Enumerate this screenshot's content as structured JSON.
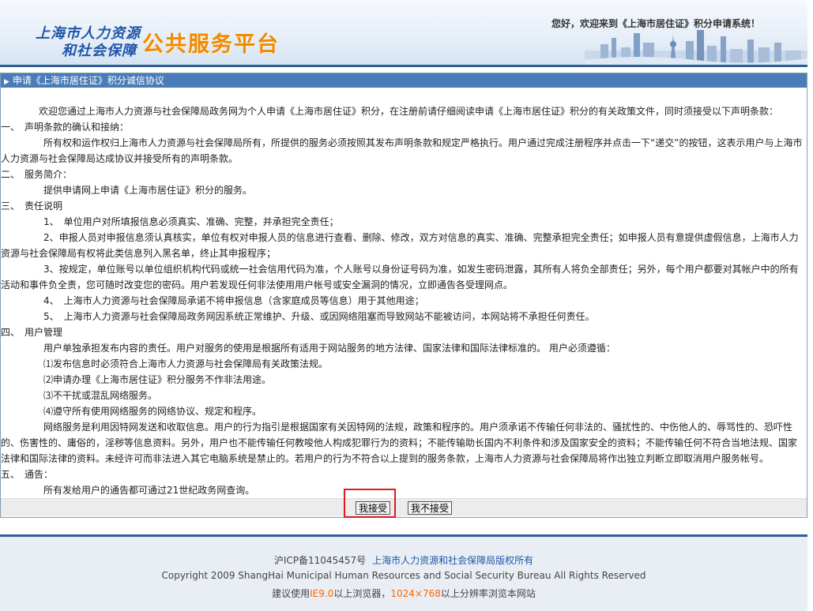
{
  "header": {
    "logo_line1": "上海市人力资源",
    "logo_line2": "和社会保障",
    "logo_platform": "公共服务平台",
    "welcome": "您好，欢迎来到《上海市居住证》积分申请系统！"
  },
  "panel": {
    "title": "申请《上海市居住证》积分诚信协议"
  },
  "content": {
    "intro": "欢迎您通过上海市人力资源与社会保障局政务网为个人申请《上海市居住证》积分，在注册前请仔细阅读申请《上海市居住证》积分的有关政策文件，同时须接受以下声明条款：",
    "s1_title": "一、　声明条款的确认和接纳：",
    "s1_text": "所有权和运作权归上海市人力资源与社会保障局所有，所提供的服务必须按照其发布声明条款和规定严格执行。用户通过完成注册程序并点击一下“递交”的按钮，这表示用户与上海市人力资源与社会保障局达成协议并接受所有的声明条款。",
    "s2_title": "二、　服务简介：",
    "s2_text": "提供申请网上申请《上海市居住证》积分的服务。",
    "s3_title": "三、　责任说明",
    "s3_item1": "1、　单位用户对所填报信息必须真实、准确、完整，并承担完全责任；",
    "s3_item2": "2、申报人员对申报信息须认真核实，单位有权对申报人员的信息进行查看、删除、修改，双方对信息的真实、准确、完整承担完全责任；如申报人员有意提供虚假信息，上海市人力资源与社会保障局有权将此类信息列入黑名单，终止其申报程序；",
    "s3_item3": "3、按规定，单位账号以单位组织机构代码或统一社会信用代码为准，个人账号以身份证号码为准，如发生密码泄露，其所有人将负全部责任；另外，每个用户都要对其帐户中的所有活动和事件负全责，您可随时改变您的密码。用户若发现任何非法使用用户帐号或安全漏洞的情况，立即通告各受理网点。",
    "s3_item4": "4、　上海市人力资源与社会保障局承诺不将申报信息（含家庭成员等信息）用于其他用途；",
    "s3_item5": "5、　上海市人力资源与社会保障局政务网因系统正常维护、升级、或因网络阻塞而导致网站不能被访问，本网站将不承担任何责任。",
    "s4_title": "四、　用户管理",
    "s4_text": "用户单独承担发布内容的责任。用户对服务的使用是根据所有适用于网站服务的地方法律、国家法律和国际法律标准的。 用户必须遵循：",
    "s4_item1": "⑴发布信息时必须符合上海市人力资源与社会保障局有关政策法规。",
    "s4_item2": "⑵申请办理《上海市居住证》积分服务不作非法用途。",
    "s4_item3": "⑶不干扰或混乱网络服务。",
    "s4_item4": "⑷遵守所有使用网络服务的网络协议、规定和程序。",
    "s4_text2": "网络服务是利用因特网发送和收取信息。用户的行为指引是根据国家有关因特网的法规，政策和程序的。用户须承诺不传输任何非法的、骚扰性的、中伤他人的、辱骂性的、恐吓性的、伤害性的、庸俗的，淫秽等信息资料。另外，用户也不能传输任何教唆他人构成犯罪行为的资料；不能传输助长国内不利条件和涉及国家安全的资料；不能传输任何不符合当地法规、国家法律和国际法律的资料。未经许可而非法进入其它电脑系统是禁止的。若用户的行为不符合以上提到的服务条款，上海市人力资源与社会保障局将作出独立判断立即取消用户服务帐号。",
    "s5_title": "五、　通告：",
    "s5_text": "所有发给用户的通告都可通过21世纪政务网查询。"
  },
  "buttons": {
    "accept": "我接受",
    "reject": "我不接受"
  },
  "footer": {
    "icp": "沪ICP备11045457号",
    "owner": "上海市人力资源和社会保障局版权所有",
    "copyright": "Copyright 2009 ShangHai Municipal Human Resources and Social Security Bureau All Rights Reserved",
    "browser_prefix": "建议使用",
    "browser_ie": "IE9.0",
    "browser_mid": "以上浏览器，",
    "browser_res": "1024×768",
    "browser_suffix": "以上分辨率浏览本网站"
  },
  "colors": {
    "accent": "#4a7cb7",
    "brand_blue": "#1f56a8",
    "brand_orange": "#f08a00",
    "highlight_red": "#e0191f"
  }
}
